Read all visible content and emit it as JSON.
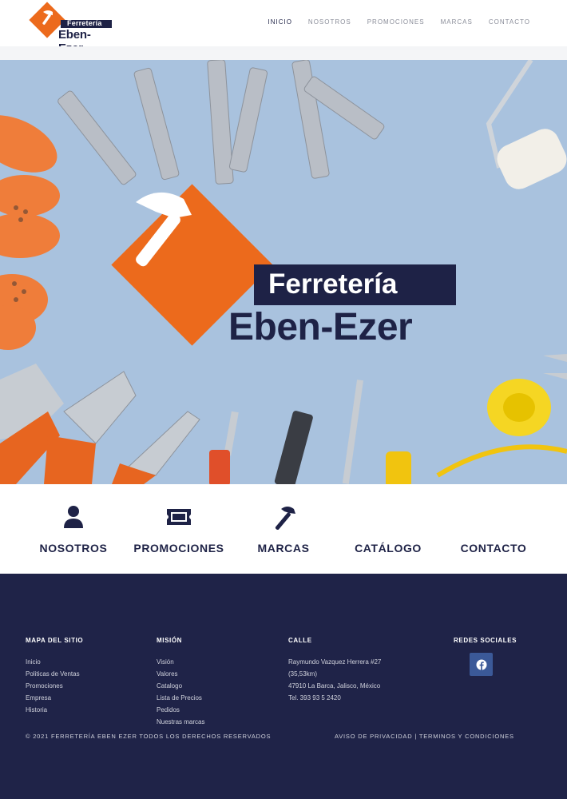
{
  "brand": {
    "name_top": "Ferretería",
    "name_bottom": "Eben-Ezer"
  },
  "nav": {
    "items": [
      {
        "label": "INICIO",
        "active": true
      },
      {
        "label": "NOSOTROS",
        "active": false
      },
      {
        "label": "PROMOCIONES",
        "active": false
      },
      {
        "label": "MARCAS",
        "active": false
      },
      {
        "label": "CONTACTO",
        "active": false
      }
    ]
  },
  "features": [
    {
      "label": "NOSOTROS",
      "icon": "user-icon"
    },
    {
      "label": "PROMOCIONES",
      "icon": "ticket-icon"
    },
    {
      "label": "MARCAS",
      "icon": "hammer-icon"
    },
    {
      "label": "CATÁLOGO",
      "icon": "none"
    },
    {
      "label": "CONTACTO",
      "icon": "none"
    }
  ],
  "footer": {
    "sitemap": {
      "title": "MAPA DEL SITIO",
      "items": [
        "Inicio",
        "Politicas de Ventas",
        "Promociones",
        "Empresa",
        "Historia"
      ]
    },
    "mission": {
      "title": "MISIÓN",
      "items": [
        "Visión",
        "Valores",
        "Catalogo",
        "Lista de Precios",
        "Pedidos",
        "Nuestras marcas"
      ]
    },
    "address": {
      "title": "CALLE",
      "lines": [
        "Raymundo Vazquez Herrera #27",
        "(35,53km)",
        "47910 La Barca, Jalisco, México",
        "Tel. 393 93 5 2420"
      ]
    },
    "social": {
      "title": "REDES SOCIALES",
      "icon": "facebook-icon"
    },
    "copyright": "© 2021 FERRETERÍA EBEN EZER TODOS LOS DERECHOS RESERVADOS",
    "legal": "AVISO DE PRIVACIDAD | TERMINOS Y CONDICIONES"
  },
  "colors": {
    "accent": "#ec6a1c",
    "navy": "#1e2246",
    "hero_bg": "#a9c2de",
    "footer_bg": "#1f2348",
    "facebook": "#3b5998"
  }
}
